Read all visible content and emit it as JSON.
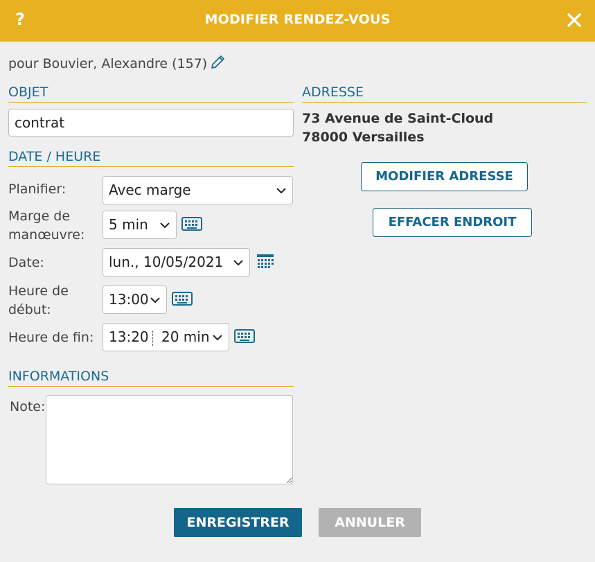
{
  "window": {
    "title": "MODIFIER RENDEZ-VOUS",
    "help_label": "?"
  },
  "subtitle": "pour Bouvier, Alexandre (157)",
  "sections": {
    "objet": "OBJET",
    "date_heure": "DATE / HEURE",
    "informations": "INFORMATIONS",
    "adresse": "ADRESSE"
  },
  "objet": {
    "value": "contrat"
  },
  "planifier": {
    "label": "Planifier:",
    "value": "Avec marge"
  },
  "marge": {
    "label_line1": "Marge de",
    "label_line2": "manœuvre:",
    "value": "5 min"
  },
  "date": {
    "label": "Date:",
    "value": "lun., 10/05/2021"
  },
  "heure_debut": {
    "label_line1": "Heure de",
    "label_line2": "début:",
    "value": "13:00"
  },
  "heure_fin": {
    "label": "Heure de fin:",
    "time": "13:20",
    "duration": "20 min"
  },
  "informations": {
    "note_label": "Note:",
    "note_value": ""
  },
  "adresse": {
    "line1": "73 Avenue de Saint-Cloud",
    "line2": "78000 Versailles",
    "modify_button": "MODIFIER ADRESSE",
    "clear_button": "EFFACER ENDROIT"
  },
  "buttons": {
    "save": "ENREGISTRER",
    "cancel": "ANNULER"
  },
  "colors": {
    "header": "#e8b121",
    "section_blue": "#1c6a91",
    "primary_button": "#13658c",
    "secondary_button": "#b2b2b2",
    "background": "#efefef"
  },
  "icons": [
    "help",
    "close-icon",
    "pencil-icon",
    "chevron-down-icon",
    "keyboard-icon",
    "calendar-icon"
  ]
}
